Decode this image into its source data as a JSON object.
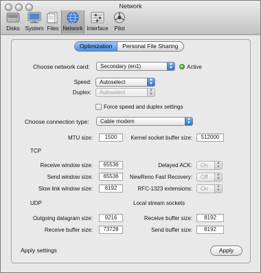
{
  "window": {
    "title": "Network"
  },
  "toolbar": {
    "items": [
      {
        "label": "Disks",
        "icon": "disks-icon"
      },
      {
        "label": "System",
        "icon": "system-monitor-icon"
      },
      {
        "label": "Files",
        "icon": "files-icon"
      },
      {
        "label": "Network",
        "icon": "network-globe-icon",
        "selected": true
      },
      {
        "label": "Interface",
        "icon": "interface-sliders-icon"
      },
      {
        "label": "Pilot",
        "icon": "pilot-icon"
      }
    ]
  },
  "tabs": [
    {
      "label": "Optimization",
      "active": true
    },
    {
      "label": "Personal File Sharing",
      "active": false
    }
  ],
  "network_card": {
    "label": "Choose network card:",
    "value": "Secondary (en1)",
    "status": "Active",
    "status_color": "#3cb72d"
  },
  "speed": {
    "label": "Speed:",
    "value": "Autoselect"
  },
  "duplex": {
    "label": "Duplex:",
    "value": "Autoselect"
  },
  "force_checkbox": {
    "label": "Force speed and duplex settings",
    "checked": false
  },
  "connection_type": {
    "label": "Choose connection type:",
    "value": "Cable modem"
  },
  "mtu": {
    "label": "MTU size:",
    "value": "1500"
  },
  "kernel_buffer": {
    "label": "Kernel socket buffer size:",
    "value": "512000"
  },
  "tcp": {
    "heading": "TCP",
    "receive_window": {
      "label": "Receive window size:",
      "value": "65536"
    },
    "send_window": {
      "label": "Send window size:",
      "value": "65536"
    },
    "slow_link": {
      "label": "Slow link window size:",
      "value": "8192"
    },
    "delayed_ack": {
      "label": "Delayed ACK:",
      "value": "On"
    },
    "newreno": {
      "label": "NewReno Fast Recovery:",
      "value": "Off"
    },
    "rfc1323": {
      "label": "RFC-1323 extensions:",
      "value": "On"
    }
  },
  "udp": {
    "heading": "UDP",
    "outgoing_datagram": {
      "label": "Outgoing datagram size:",
      "value": "9216"
    },
    "receive_buffer": {
      "label": "Receive buffer size:",
      "value": "73728"
    }
  },
  "local_stream": {
    "heading": "Local stream sockets",
    "receive_buffer": {
      "label": "Receive buffer size:",
      "value": "8192"
    },
    "send_buffer": {
      "label": "Send buffer size:",
      "value": "8192"
    }
  },
  "footer": {
    "apply_settings_label": "Apply settings",
    "apply_button": "Apply"
  },
  "colors": {
    "accent_blue": "#4d8ee6",
    "window_bg": "#e8e8e8"
  }
}
